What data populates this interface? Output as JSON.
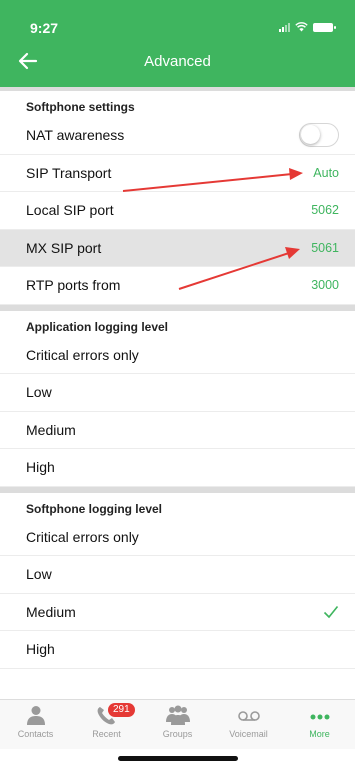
{
  "status_bar": {
    "time": "9:27"
  },
  "header": {
    "title": "Advanced"
  },
  "softphone_settings": {
    "title": "Softphone settings",
    "rows": [
      {
        "label": "NAT awareness",
        "type": "toggle",
        "enabled": false
      },
      {
        "label": "SIP Transport",
        "value": "Auto"
      },
      {
        "label": "Local SIP port",
        "value": "5062"
      },
      {
        "label": "MX SIP port",
        "value": "5061"
      },
      {
        "label": "RTP ports from",
        "value": "3000"
      }
    ]
  },
  "app_logging": {
    "title": "Application logging level",
    "options": [
      "Critical errors only",
      "Low",
      "Medium",
      "High"
    ]
  },
  "softphone_logging": {
    "title": "Softphone logging level",
    "options": [
      "Critical errors only",
      "Low",
      "Medium",
      "High"
    ],
    "selected": "Medium"
  },
  "tabbar": {
    "tabs": [
      {
        "label": "Contacts",
        "icon": "person-icon"
      },
      {
        "label": "Recent",
        "icon": "phone-icon",
        "badge": "291"
      },
      {
        "label": "Groups",
        "icon": "group-icon"
      },
      {
        "label": "Voicemail",
        "icon": "voicemail-icon"
      },
      {
        "label": "More",
        "icon": "more-dots-icon",
        "active": true
      }
    ]
  },
  "colors": {
    "accent": "#3fb55f",
    "annotation_arrow": "#e53935",
    "badge": "#e53935"
  }
}
